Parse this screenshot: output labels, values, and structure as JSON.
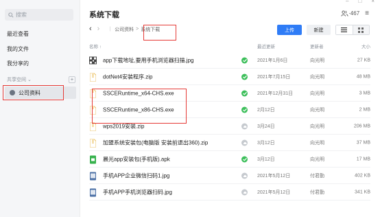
{
  "sidebar": {
    "search_placeholder": "搜索",
    "items": [
      {
        "label": "最近查看"
      },
      {
        "label": "我的文件"
      },
      {
        "label": "我分享的"
      }
    ],
    "group_label": "共享空间",
    "group_add": "+",
    "selected_space": "公司资料"
  },
  "window": {
    "minimize": "–",
    "maximize": "□",
    "close": "×"
  },
  "header": {
    "title": "系统下载",
    "member_count": "467",
    "member_prefix": "·",
    "menu_icon": "≡"
  },
  "breadcrumb": {
    "back": "‹",
    "forward": "›",
    "items": [
      "公司资料",
      "系统下载"
    ],
    "separator": ">"
  },
  "toolbar": {
    "upload_label": "上传",
    "new_label": "新建"
  },
  "table": {
    "columns": {
      "name": "名称 ↑",
      "date": "最近更新",
      "user": "更新者",
      "size": "大小"
    },
    "rows": [
      {
        "icon": "qr-image-icon",
        "name": "app下载地址,要用手机浏览器扫描.jpg",
        "status": "synced",
        "date": "2021年1月6日",
        "user": "向光明",
        "size": "27 KB"
      },
      {
        "icon": "zip-icon",
        "name": "dotNet4安装程序.zip",
        "status": "synced",
        "date": "2021年7月15日",
        "user": "向光明",
        "size": "48 MB"
      },
      {
        "icon": "exe-icon",
        "name": "SSCERuntime_x64-CHS.exe",
        "status": "synced",
        "date": "2021年12月31日",
        "user": "向光明",
        "size": "3 MB"
      },
      {
        "icon": "exe-icon",
        "name": "SSCERuntime_x86-CHS.exe",
        "status": "synced",
        "date": "2月12日",
        "user": "向光明",
        "size": "2 MB"
      },
      {
        "icon": "zip-icon",
        "name": "wps2019安装.zip",
        "status": "cloud",
        "date": "3月24日",
        "user": "向光明",
        "size": "206 MB"
      },
      {
        "icon": "zip-icon",
        "name": "加盟系统安装包(电脑版 安装前退出360).zip",
        "status": "cloud",
        "date": "3月12日",
        "user": "向光明",
        "size": "37 MB"
      },
      {
        "icon": "apk-icon",
        "name": "晨光app安装包(手机版).apk",
        "status": "synced",
        "date": "3月12日",
        "user": "向光明",
        "size": "17 MB"
      },
      {
        "icon": "phone-image-icon",
        "name": "手机APP企业微信扫码1.jpg",
        "status": "cloud",
        "date": "2021年5月12日",
        "user": "付君勤",
        "size": "402 KB"
      },
      {
        "icon": "phone-image-icon",
        "name": "手机APP手机浏览器扫码.jpg",
        "status": "cloud",
        "date": "2021年5月12日",
        "user": "付君勤",
        "size": "341 KB"
      }
    ]
  },
  "colors": {
    "accent": "#2f7cf6",
    "highlight": "#e53935",
    "synced": "#3dbf5b"
  }
}
